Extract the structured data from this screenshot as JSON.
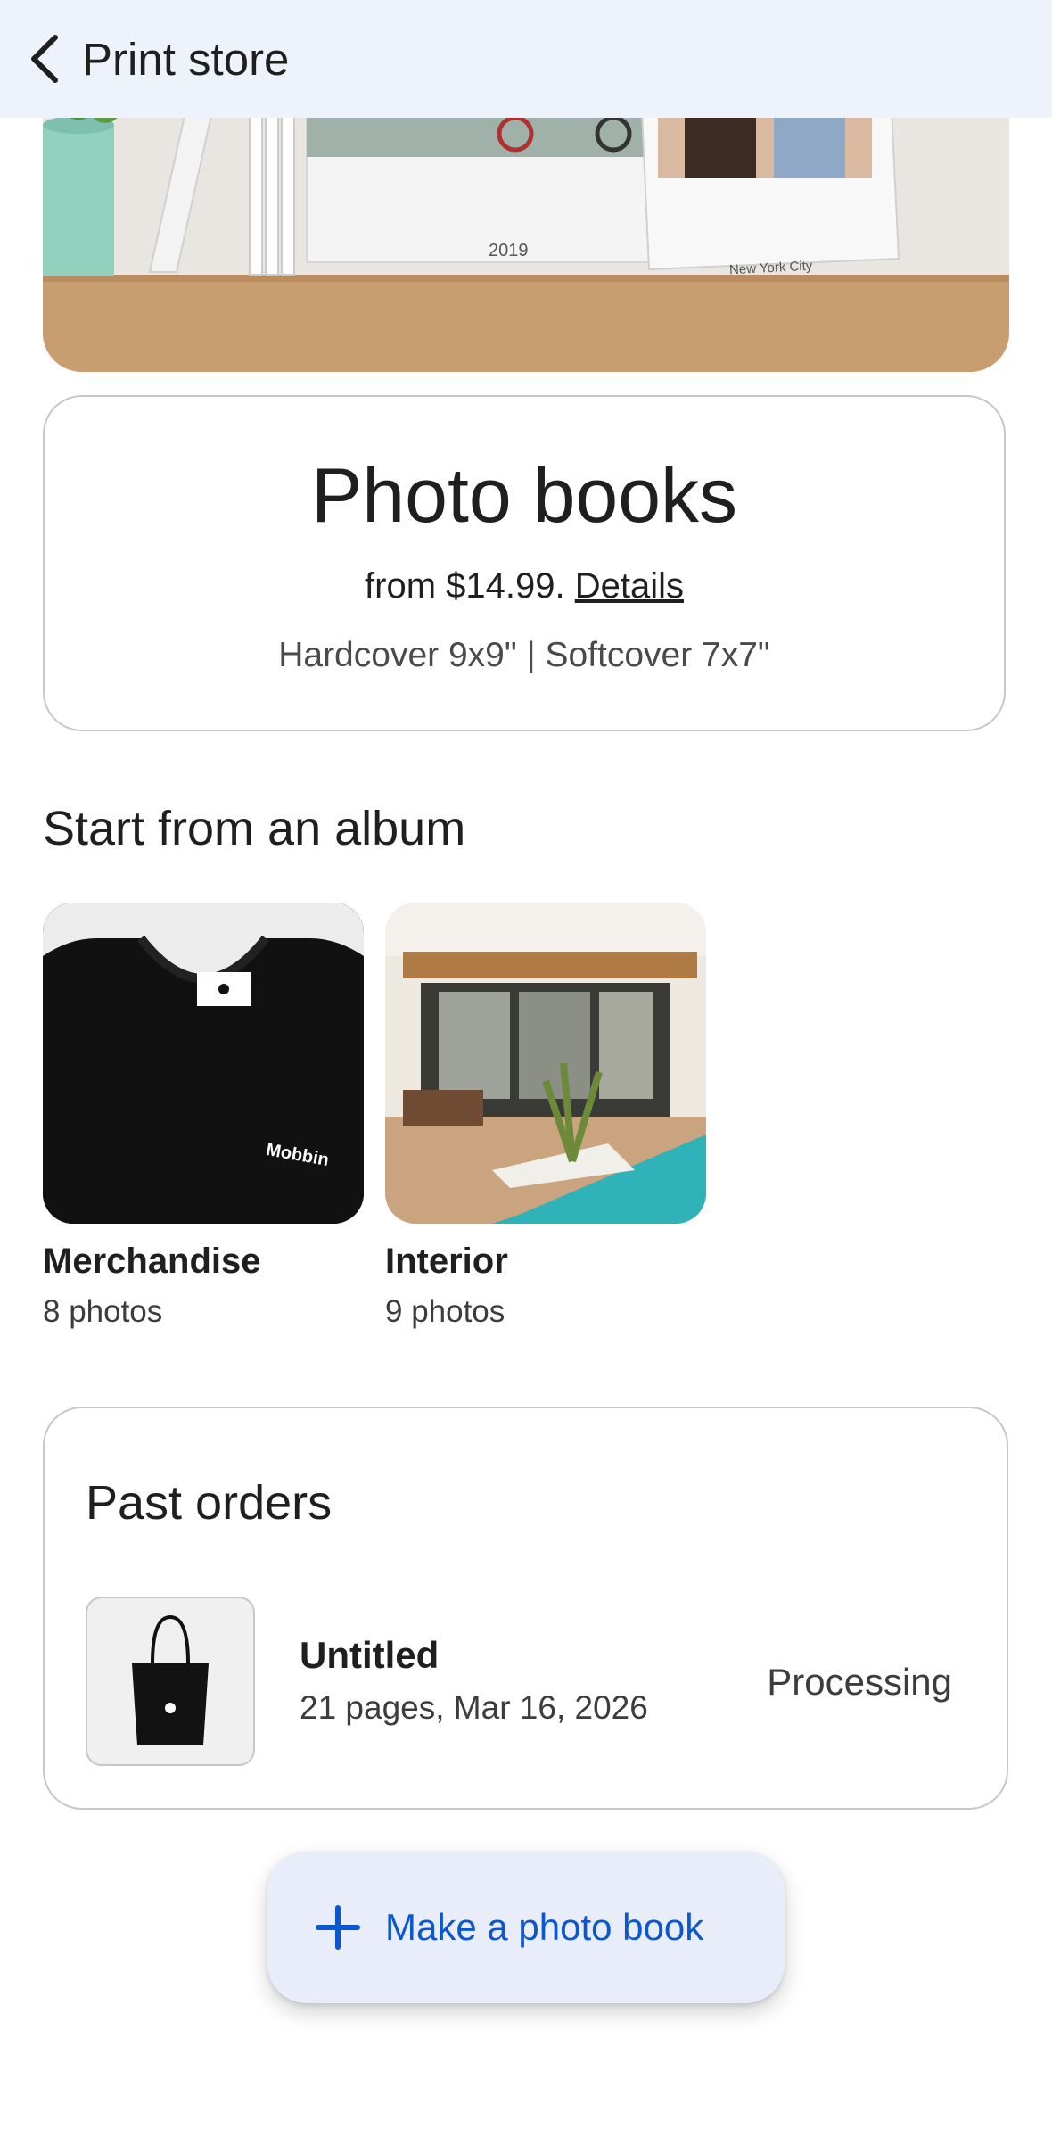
{
  "appbar": {
    "title": "Print store",
    "back_icon": "back-arrow-icon"
  },
  "hero": {
    "book_left_text": "2019",
    "book_right_text": "New York City"
  },
  "photobooks": {
    "title": "Photo books",
    "price_text": "from $14.99.",
    "details_link": "Details",
    "sizes": "Hardcover 9x9\" | Softcover 7x7\""
  },
  "albums_section": {
    "title": "Start from an album",
    "items": [
      {
        "name": "Merchandise",
        "count": "8 photos",
        "thumb_text": "Mobbin"
      },
      {
        "name": "Interior",
        "count": "9 photos"
      }
    ]
  },
  "past_orders": {
    "title": "Past orders",
    "orders": [
      {
        "name": "Untitled",
        "meta": "21 pages, Mar 16, 2026",
        "status": "Processing"
      }
    ]
  },
  "fab": {
    "label": "Make a photo book",
    "icon": "plus-icon"
  },
  "colors": {
    "accent": "#0b57d0",
    "appbar_bg": "#eef2fa",
    "fab_bg": "#e8edf9",
    "border": "#c7c7c7"
  }
}
